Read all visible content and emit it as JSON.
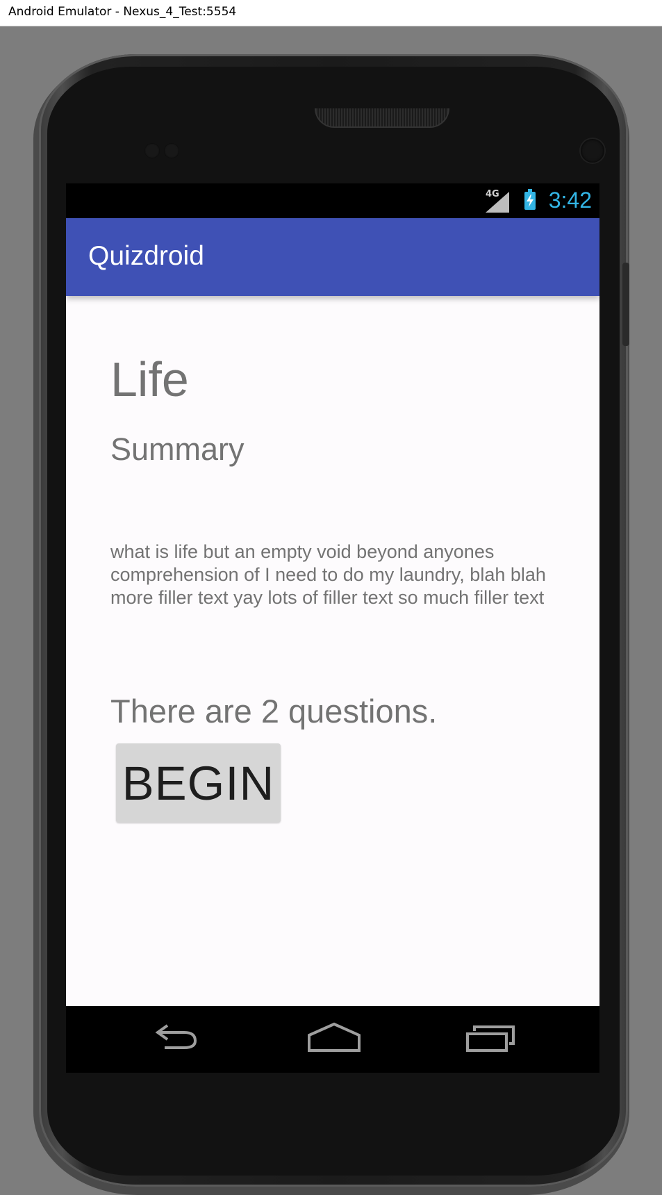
{
  "window": {
    "title": "Android Emulator - Nexus_4_Test:5554"
  },
  "status_bar": {
    "network_label": "4G",
    "time": "3:42",
    "accent_color": "#33b5e5"
  },
  "action_bar": {
    "title": "Quizdroid",
    "color": "#3f51b5"
  },
  "content": {
    "topic_title": "Life",
    "summary_heading": "Summary",
    "description": "what is life but an empty void beyond anyones comprehension of I need to do my laundry, blah blah more filler text yay lots of filler text so much filler text",
    "question_count_text": "There are 2 questions.",
    "begin_button_label": "BEGIN"
  },
  "navigation_bar": {
    "back_icon": "back-arrow-icon",
    "home_icon": "home-icon",
    "recent_icon": "recent-apps-icon"
  }
}
